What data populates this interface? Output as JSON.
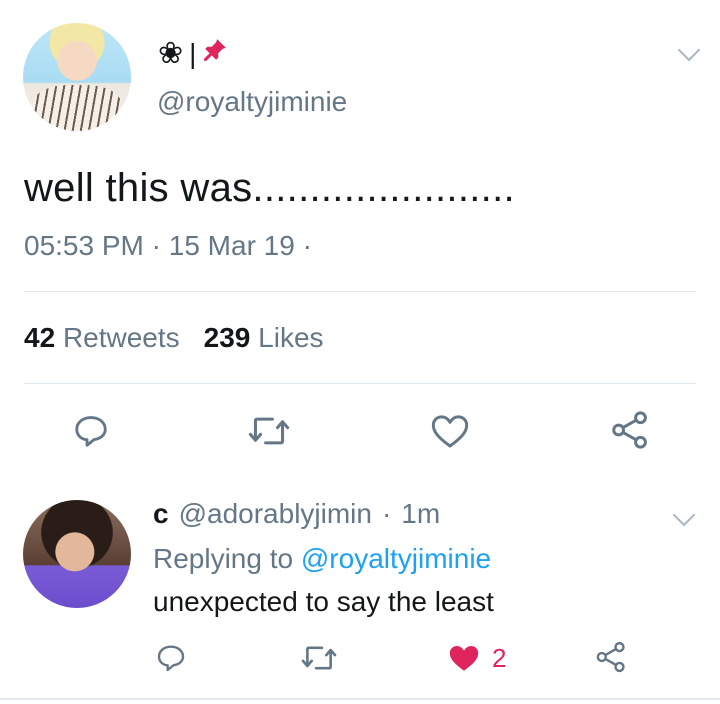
{
  "tweet": {
    "display_name_icons": [
      "flower-icon",
      "pin-icon"
    ],
    "name_separator": "|",
    "handle": "@royaltyjiminie",
    "text": "well this was.......................",
    "time": "05:53 PM",
    "date": "15 Mar 19",
    "meta_separator": "·",
    "retweets_count": "42",
    "retweets_label": "Retweets",
    "likes_count": "239",
    "likes_label": "Likes"
  },
  "reply": {
    "name": "c",
    "handle": "@adorablyjimin",
    "separator": "·",
    "time": "1m",
    "replying_label": "Replying to",
    "replying_to": "@royaltyjiminie",
    "text": "unexpected to say the least",
    "like_count": "2"
  },
  "actions": [
    "reply-icon",
    "retweet-icon",
    "like-icon",
    "share-icon"
  ],
  "colors": {
    "text": "#14171a",
    "secondary": "#657786",
    "accent": "#1da1f2",
    "like": "#e0245e",
    "icon": "#657786",
    "divider": "#e1e8ed"
  }
}
